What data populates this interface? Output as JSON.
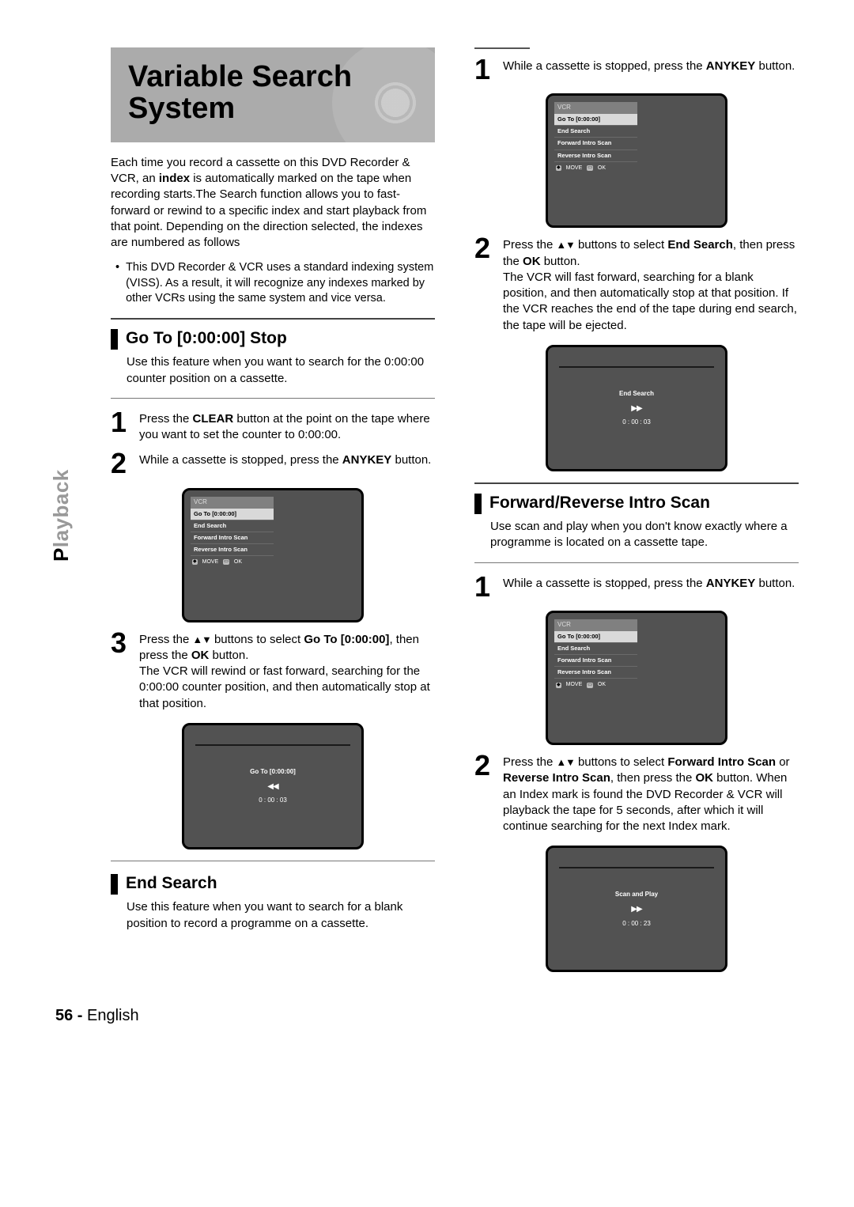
{
  "sidebar": {
    "label_prefix": "P",
    "label_rest": "layback"
  },
  "title": "Variable Search System",
  "intro": {
    "p1a": "Each time you record a cassette on this DVD Recorder & VCR, an ",
    "p1_bold": "index",
    "p1b": " is automatically marked on the tape when recording starts.The Search function allows you to fast-forward or rewind to a specific index and start playback from that point. Depending on the direction selected, the indexes are numbered as follows",
    "bullet": "This DVD Recorder & VCR uses a standard indexing system (VISS). As a result, it will recognize any indexes marked by other VCRs using the same system and vice versa."
  },
  "goto": {
    "title": "Go To [0:00:00] Stop",
    "desc": "Use this feature when you want to search for the 0:00:00 counter position on a cassette.",
    "step1a": "Press the ",
    "step1_bold": "CLEAR",
    "step1b": " button at the point on the tape where you want to set the counter to 0:00:00.",
    "step2a": "While a cassette is stopped, press the ",
    "step2_bold": "ANYKEY",
    "step2b": " button.",
    "step3a": "Press the ",
    "step3b": " buttons to select ",
    "step3_bold1": "Go To [0:00:00]",
    "step3c": ", then press the ",
    "step3_bold2": "OK",
    "step3d": " button.",
    "step3e": "The VCR will rewind or fast forward, searching for the 0:00:00 counter position, and then automatically stop at that position."
  },
  "endsearch": {
    "title": "End Search",
    "desc": "Use this feature when you want to search for a blank position to record a programme on a cassette.",
    "step1a": "While a cassette is stopped, press the ",
    "step1_bold": "ANYKEY",
    "step1b": " button.",
    "step2a": "Press the ",
    "step2b": " buttons to select ",
    "step2_bold1": "End Search",
    "step2c": ", then press the ",
    "step2_bold2": "OK",
    "step2d": " button.",
    "step2e": "The VCR will fast forward, searching for a blank position, and then automatically stop at that position. If the VCR reaches the end of the tape during end search, the tape will be ejected."
  },
  "intro_scan": {
    "title": "Forward/Reverse Intro Scan",
    "desc": "Use scan and play when you don't know exactly where a programme is located on a cassette tape.",
    "step1a": "While a cassette is stopped, press the ",
    "step1_bold": "ANYKEY",
    "step1b": " button.",
    "step2a": "Press the ",
    "step2b": " buttons to select ",
    "step2_bold1": "Forward Intro Scan",
    "step2c": " or ",
    "step2_bold2": "Reverse Intro Scan",
    "step2d": ", then press the ",
    "step2_bold3": "OK",
    "step2e": " button. When an Index mark is found the DVD Recorder & VCR will playback the tape for 5 seconds, after which it will continue searching for the next Index mark."
  },
  "osd_menu": {
    "header": "VCR",
    "items": [
      "Go To [0:00:00]",
      "End Search",
      "Forward Intro Scan",
      "Reverse Intro Scan"
    ],
    "foot_move": "MOVE",
    "foot_ok": "OK"
  },
  "osd_goto": {
    "label": "Go To [0:00:00]",
    "arrows": "◀◀",
    "time": "0 : 00 : 03"
  },
  "osd_end": {
    "label": "End Search",
    "arrows": "▶▶",
    "time": "0 : 00 : 03"
  },
  "osd_scan": {
    "label": "Scan and Play",
    "arrows": "▶▶",
    "time": "0 : 00 : 23"
  },
  "footer": {
    "page": "56 - ",
    "lang": "English"
  }
}
